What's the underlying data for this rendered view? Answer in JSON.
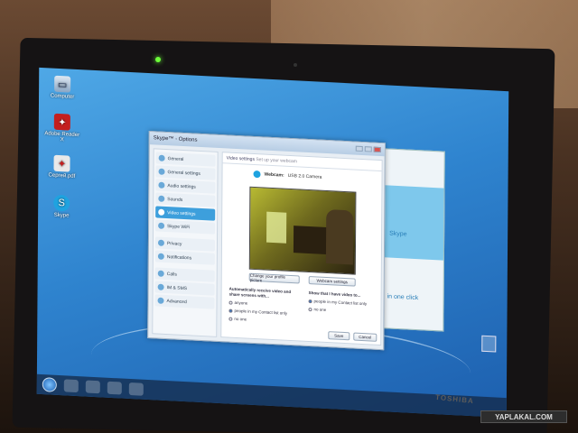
{
  "desktop": {
    "icons": [
      {
        "label": "Computer",
        "icon": "computer-icon"
      },
      {
        "label": "Adobe Reader X",
        "icon": "pdf-icon"
      },
      {
        "label": "Сергей.pdf",
        "icon": "pdf-file-icon"
      },
      {
        "label": "Skype",
        "icon": "skype-icon"
      }
    ]
  },
  "options_window": {
    "title": "Skype™ - Options",
    "header": "Video settings",
    "header_sub": "Set up your webcam",
    "nav": [
      {
        "label": "General",
        "selected": false
      },
      {
        "label": "General settings",
        "selected": false
      },
      {
        "label": "Audio settings",
        "selected": false
      },
      {
        "label": "Sounds",
        "selected": false
      },
      {
        "label": "Video settings",
        "selected": true
      },
      {
        "label": "Skype WiFi",
        "selected": false
      },
      {
        "label": "Privacy",
        "selected": false
      },
      {
        "label": "Notifications",
        "selected": false
      },
      {
        "label": "Calls",
        "selected": false
      },
      {
        "label": "IM & SMS",
        "selected": false
      },
      {
        "label": "Advanced",
        "selected": false
      }
    ],
    "webcam_label": "Webcam:",
    "webcam_value": "USB 2.0 Camera",
    "change_button": "Change your profile picture",
    "webcam_settings_button": "Webcam settings",
    "auto_receive": {
      "label": "Automatically receive video and share screens with...",
      "options": [
        "anyone",
        "people in my Contact list only",
        "no one"
      ],
      "selected": 1
    },
    "show_that": {
      "label": "Show that I have video to...",
      "options": [
        "people in my Contact list only",
        "no one"
      ],
      "selected": 0
    },
    "save_button": "Save",
    "cancel_button": "Cancel"
  },
  "skype_bg": {
    "brand": "Skype",
    "text": "in one click"
  },
  "watermark": "YAPLAKAL.COM",
  "laptop_brand": "TOSHIBA"
}
